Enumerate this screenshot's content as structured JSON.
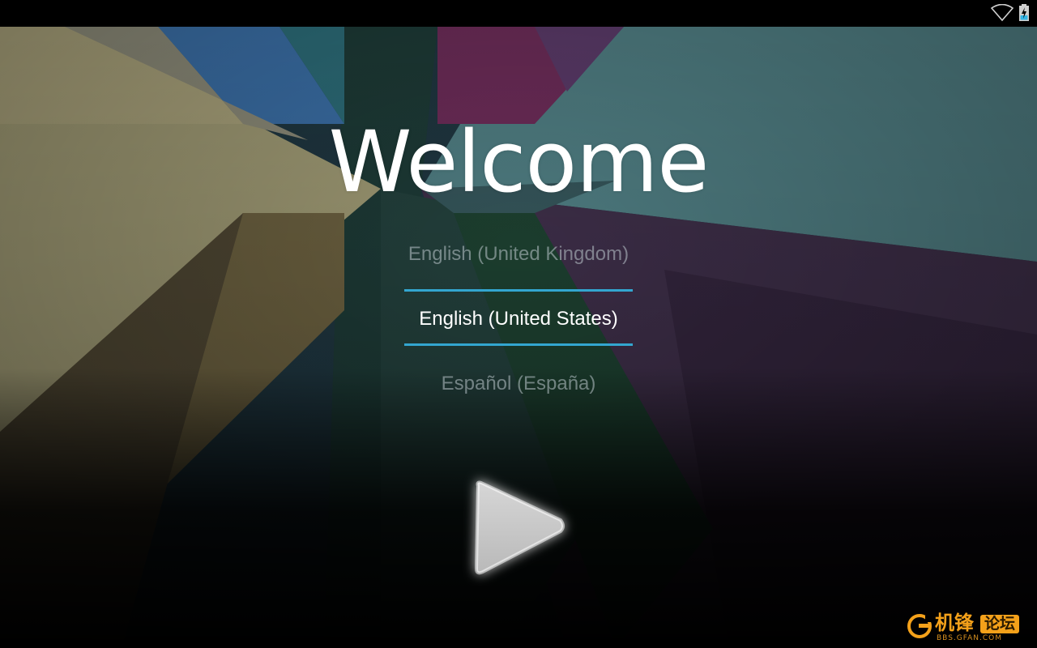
{
  "status_bar": {
    "icons": [
      "wifi-icon",
      "battery-charging-icon"
    ]
  },
  "welcome": {
    "title": "Welcome"
  },
  "language_picker": {
    "previous": "English (United Kingdom)",
    "selected": "English (United States)",
    "next": "Español (España)"
  },
  "start_button": {
    "icon": "play-arrow-icon"
  },
  "watermark": {
    "brand": "机锋",
    "badge": "论坛",
    "url": "BBS.GFAN.COM"
  },
  "colors": {
    "accent": "#33a6d0",
    "watermark": "#f4a11a",
    "background": "#000000"
  }
}
